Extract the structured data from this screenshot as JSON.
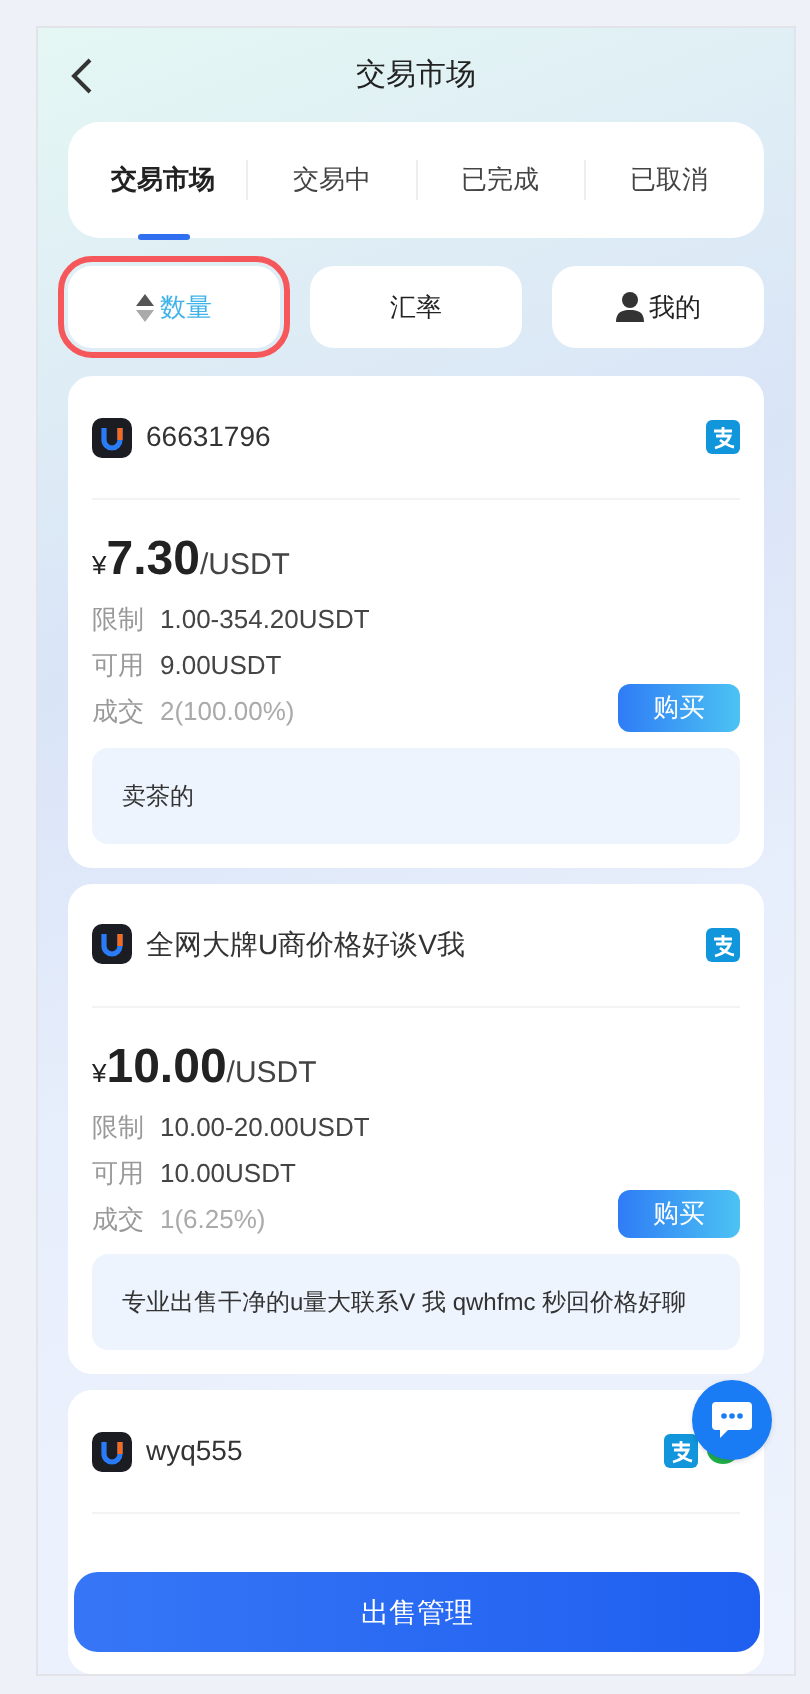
{
  "header": {
    "title": "交易市场"
  },
  "tabs": [
    {
      "label": "交易市场",
      "selected": true
    },
    {
      "label": "交易中",
      "selected": false
    },
    {
      "label": "已完成",
      "selected": false
    },
    {
      "label": "已取消",
      "selected": false
    }
  ],
  "filters": [
    {
      "kind": "sort",
      "label": "数量",
      "selected": true,
      "highlighted": true
    },
    {
      "kind": "plain",
      "label": "汇率",
      "selected": false,
      "highlighted": false
    },
    {
      "kind": "user",
      "label": "我的",
      "selected": false,
      "highlighted": false
    }
  ],
  "offers": [
    {
      "name": "66631796",
      "payments": [
        {
          "kind": "alipay"
        }
      ],
      "currency": "¥",
      "price": "7.30",
      "unit": "/USDT",
      "stats": [
        {
          "kind": "limit",
          "label": "限制",
          "value": "1.00-354.20USDT"
        },
        {
          "kind": "available",
          "label": "可用",
          "value": "9.00USDT"
        },
        {
          "kind": "deals",
          "label": "成交",
          "value": "2(100.00%)"
        }
      ],
      "buy": "购买",
      "note": "卖茶的"
    },
    {
      "name": "全网大牌U商价格好谈V我",
      "payments": [
        {
          "kind": "alipay"
        }
      ],
      "currency": "¥",
      "price": "10.00",
      "unit": "/USDT",
      "stats": [
        {
          "kind": "limit",
          "label": "限制",
          "value": "10.00-20.00USDT"
        },
        {
          "kind": "available",
          "label": "可用",
          "value": "10.00USDT"
        },
        {
          "kind": "deals",
          "label": "成交",
          "value": "1(6.25%)"
        }
      ],
      "buy": "购买",
      "note": "专业出售干净的u量大联系V 我 qwhfmc 秒回价格好聊"
    },
    {
      "name": "wyq555",
      "payments": [
        {
          "kind": "alipay"
        },
        {
          "kind": "wechat"
        }
      ]
    }
  ],
  "sell_button": "出售管理"
}
